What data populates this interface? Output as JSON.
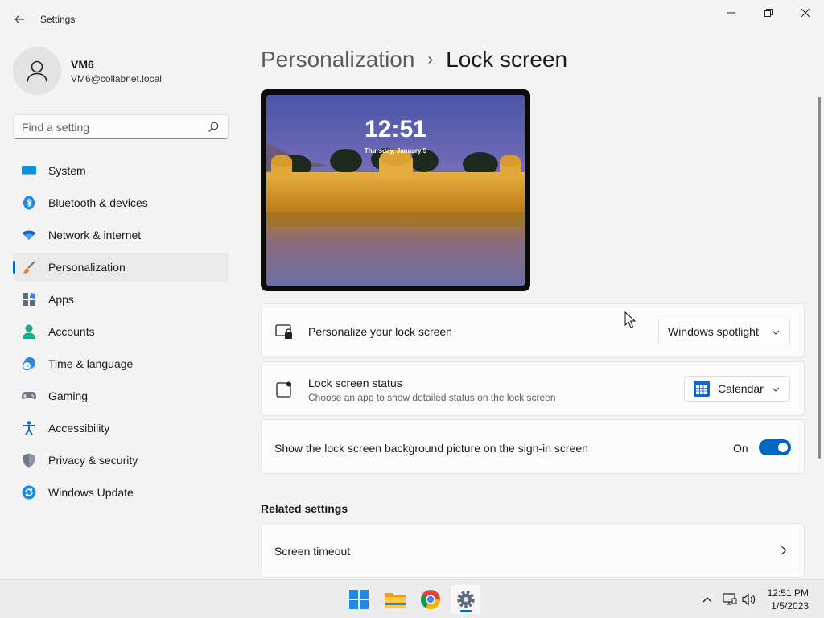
{
  "window": {
    "title": "Settings"
  },
  "profile": {
    "name": "VM6",
    "email": "VM6@collabnet.local"
  },
  "search": {
    "placeholder": "Find a setting"
  },
  "sidebar": {
    "items": [
      {
        "label": "System",
        "icon": "monitor-icon"
      },
      {
        "label": "Bluetooth & devices",
        "icon": "bluetooth-icon"
      },
      {
        "label": "Network & internet",
        "icon": "wifi-icon"
      },
      {
        "label": "Personalization",
        "icon": "brush-icon",
        "active": true
      },
      {
        "label": "Apps",
        "icon": "apps-icon"
      },
      {
        "label": "Accounts",
        "icon": "person-icon"
      },
      {
        "label": "Time & language",
        "icon": "clock-globe-icon"
      },
      {
        "label": "Gaming",
        "icon": "gamepad-icon"
      },
      {
        "label": "Accessibility",
        "icon": "accessibility-icon"
      },
      {
        "label": "Privacy & security",
        "icon": "shield-icon"
      },
      {
        "label": "Windows Update",
        "icon": "update-icon"
      }
    ]
  },
  "breadcrumb": {
    "parent": "Personalization",
    "separator": "›",
    "current": "Lock screen"
  },
  "preview": {
    "time": "12:51",
    "date": "Thursday, January 5"
  },
  "settings": {
    "personalize": {
      "title": "Personalize your lock screen",
      "value": "Windows spotlight"
    },
    "status": {
      "title": "Lock screen status",
      "subtitle": "Choose an app to show detailed status on the lock screen",
      "value": "Calendar"
    },
    "signin_bg": {
      "title": "Show the lock screen background picture on the sign-in screen",
      "state": "On",
      "enabled": true
    }
  },
  "related": {
    "title": "Related settings",
    "items": [
      {
        "label": "Screen timeout"
      }
    ]
  },
  "taskbar": {
    "apps": [
      "windows-start-icon",
      "file-explorer-icon",
      "chrome-icon",
      "settings-icon"
    ],
    "time": "12:51 PM",
    "date": "1/5/2023"
  },
  "colors": {
    "accent": "#0067c0",
    "background": "#f3f3f3",
    "card": "#fbfbfb"
  }
}
